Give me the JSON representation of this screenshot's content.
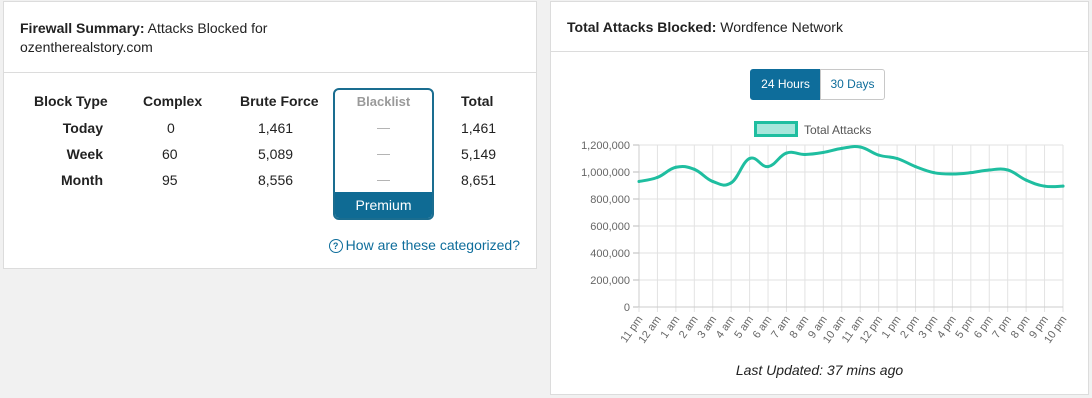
{
  "firewall": {
    "title_bold": "Firewall Summary:",
    "title_rest": "Attacks Blocked for",
    "site": "ozentherealstory.com",
    "columns": [
      "Block Type",
      "Complex",
      "Brute Force",
      "Blacklist",
      "Total"
    ],
    "rows": [
      {
        "label": "Today",
        "complex": "0",
        "brute": "1,461",
        "blacklist": "—",
        "total": "1,461"
      },
      {
        "label": "Week",
        "complex": "60",
        "brute": "5,089",
        "blacklist": "—",
        "total": "5,149"
      },
      {
        "label": "Month",
        "complex": "95",
        "brute": "8,556",
        "blacklist": "—",
        "total": "8,651"
      }
    ],
    "premium_label": "Premium",
    "help_link": "How are these categorized?",
    "help_icon": "question-circle-icon"
  },
  "total_attacks": {
    "title_bold": "Total Attacks Blocked:",
    "title_rest": "Wordfence Network",
    "tabs": [
      {
        "label": "24 Hours",
        "active": true
      },
      {
        "label": "30 Days",
        "active": false
      }
    ],
    "last_updated": "Last Updated: 37 mins ago",
    "colors": {
      "line": "#1fbea0",
      "fill": "#a7e6db",
      "accent": "#0e6d9b"
    }
  },
  "chart_data": {
    "type": "line",
    "categories": [
      "11 pm",
      "12 am",
      "1 am",
      "2 am",
      "3 am",
      "4 am",
      "5 am",
      "6 am",
      "7 am",
      "8 am",
      "9 am",
      "10 am",
      "11 am",
      "12 pm",
      "1 pm",
      "2 pm",
      "3 pm",
      "4 pm",
      "5 pm",
      "6 pm",
      "7 pm",
      "8 pm",
      "9 pm",
      "10 pm"
    ],
    "series": [
      {
        "name": "Total Attacks",
        "values": [
          930000,
          960000,
          1035000,
          1020000,
          930000,
          920000,
          1100000,
          1040000,
          1140000,
          1130000,
          1145000,
          1175000,
          1185000,
          1125000,
          1100000,
          1040000,
          995000,
          985000,
          995000,
          1015000,
          1015000,
          940000,
          895000,
          895000
        ]
      }
    ],
    "yticks": [
      "0",
      "200,000",
      "400,000",
      "600,000",
      "800,000",
      "1,000,000",
      "1,200,000"
    ],
    "ylim": [
      0,
      1200000
    ],
    "legend": "top",
    "grid": true,
    "title": "",
    "xlabel": "",
    "ylabel": ""
  }
}
